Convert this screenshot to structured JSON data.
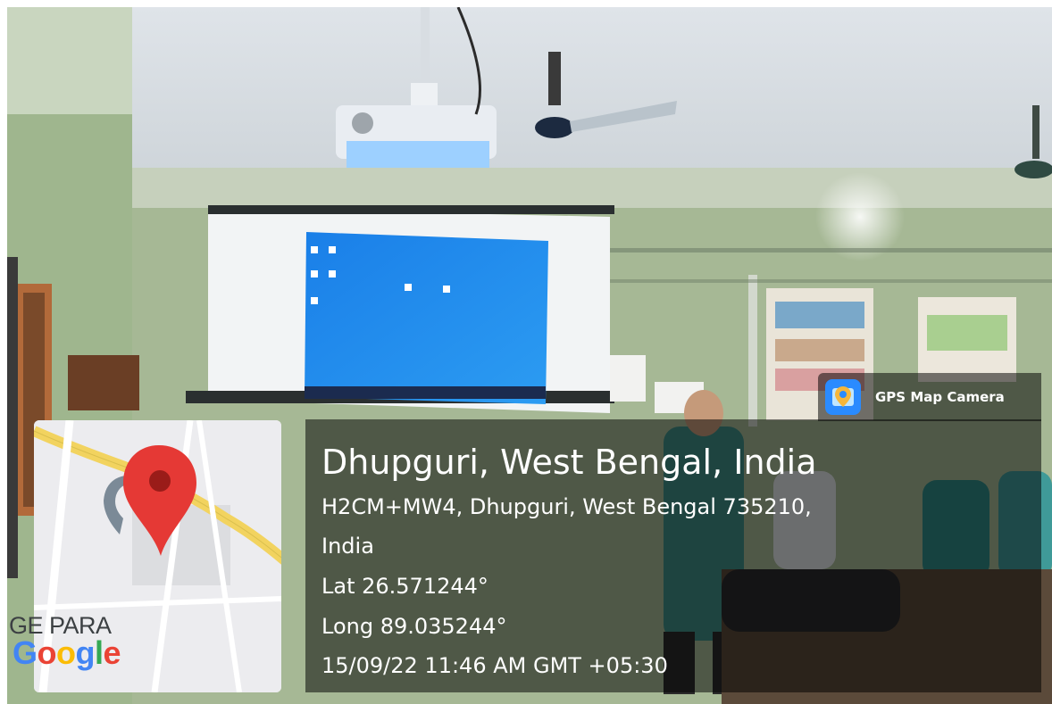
{
  "badge": {
    "label": "GPS Map Camera",
    "icon": "gps-map-camera-icon"
  },
  "location": {
    "title": "Dhupguri, West Bengal, India",
    "address_line1": "H2CM+MW4, Dhupguri, West Bengal 735210,",
    "address_line2": "India",
    "latitude": "Lat 26.571244°",
    "longitude": "Long 89.035244°",
    "datetime": "15/09/22 11:46 AM GMT +05:30"
  },
  "map": {
    "area_label": "GE PARA",
    "brand": "Google",
    "pin_icon": "map-pin-icon",
    "colors": {
      "road": "#f2d35f",
      "pin": "#e53935",
      "pin_dot": "#9a1c19"
    }
  }
}
